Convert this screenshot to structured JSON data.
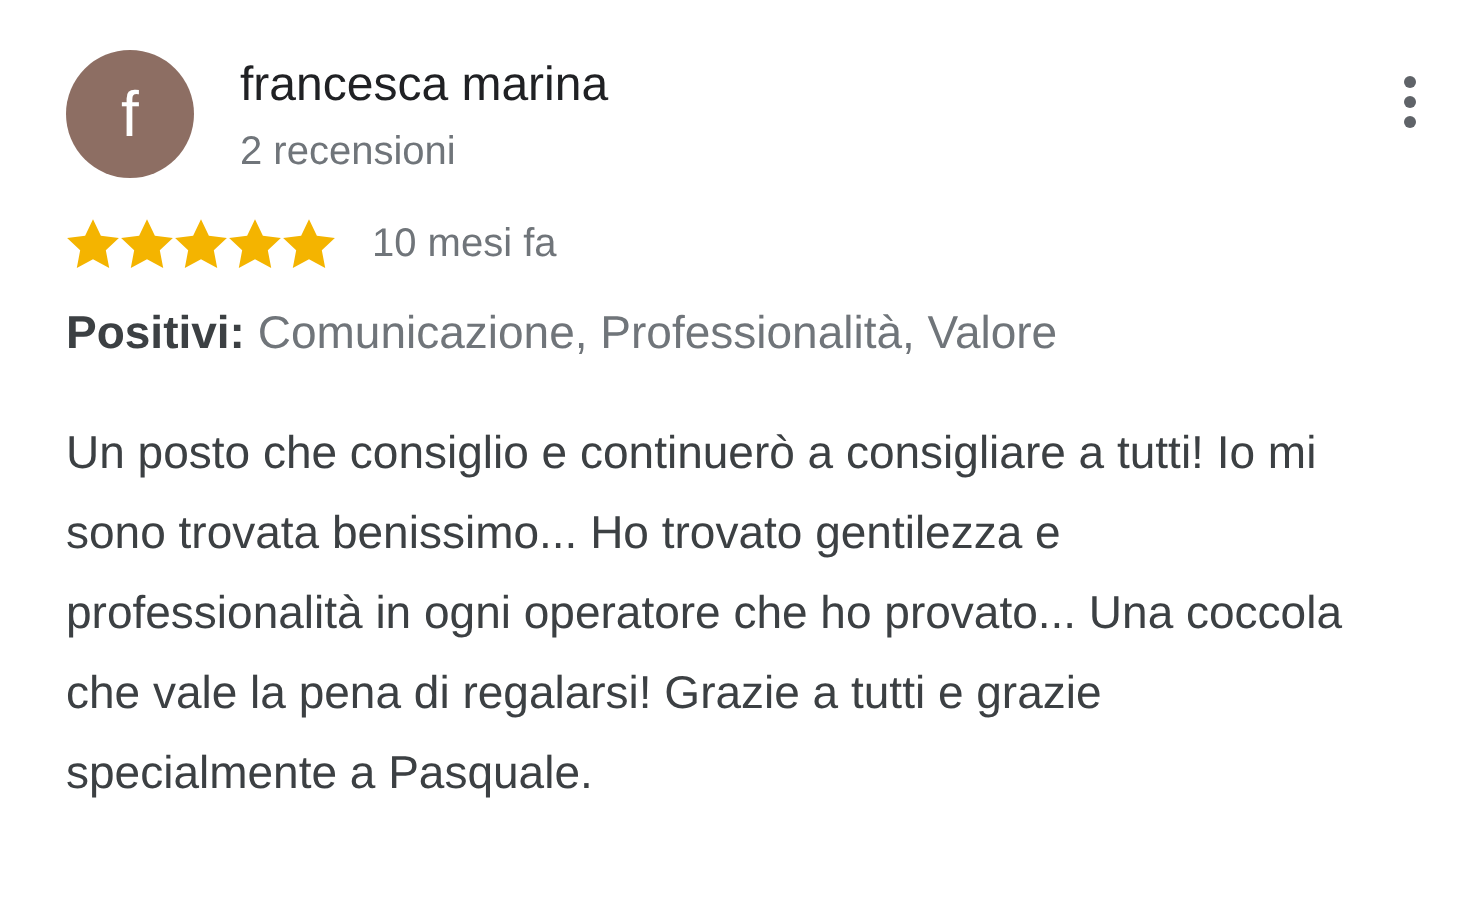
{
  "review": {
    "avatar_letter": "f",
    "author": "francesca marina",
    "review_count": "2 recensioni",
    "stars": 5,
    "time": "10 mesi fa",
    "positives_label": "Positivi:",
    "positives": "Comunicazione, Professionalità, Valore",
    "text": "Un posto che consiglio e continuerò a consigliare a tutti! Io mi sono trovata benissimo... Ho trovato gentilezza e professionalità in ogni operatore che ho provato... Una coccola che vale la pena di regalarsi! Grazie a tutti e grazie specialmente a Pasquale."
  }
}
